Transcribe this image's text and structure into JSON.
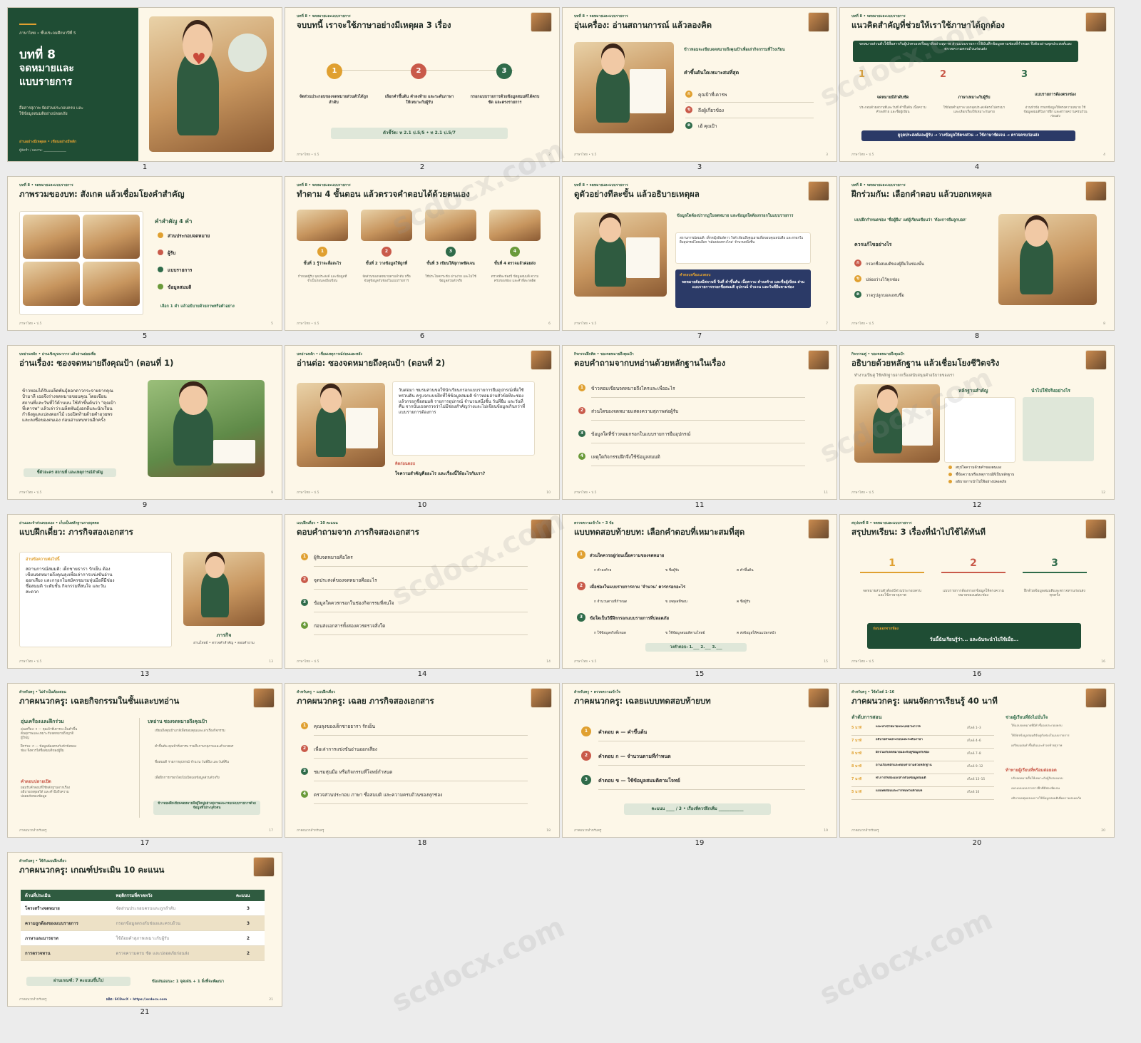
{
  "watermark": "scdocx.com",
  "slides": [
    {
      "n": "1",
      "kicker": "ภาษาไทย • ชั้นประถมศึกษาปีที่ 5",
      "title": "บทที่ 8",
      "title2": "จดหมายและ",
      "title3": "แบบรายการ",
      "desc": "สื่อสารสุภาพ จัดส่วนประกอบครบ และใช้ข้อมูลสมมติอย่างปลอดภัย",
      "tag": "อ่านอย่างมีเหตุผล • เขียนอย่างมีหลัก",
      "sub": "ผู้จัดทำ / ผลงาน: ______________"
    },
    {
      "n": "2",
      "kicker": "บทที่ 8 • จดหมายและแบบรายการ",
      "title": "จบบทนี้ เราจะใช้ภาษาอย่างมีเหตุผล 3 เรื่อง",
      "steps": [
        {
          "k": "1",
          "t": "จัดส่วนประกอบของจดหมายส่วนตัวได้ถูกลำดับ"
        },
        {
          "k": "2",
          "t": "เลือกคำขึ้นต้น คำลงท้าย และระดับภาษาให้เหมาะกับผู้รับ"
        },
        {
          "k": "3",
          "t": "กรอกแบบรายการด้วยข้อมูลสมมติได้ครบ ชัด และตรงรายการ"
        }
      ],
      "note": "ตัวชี้วัด: ท 2.1 ป.5/5 • ท 2.1 ป.5/7",
      "foot": "ภาษาไทย • ป.5",
      "p": "2"
    },
    {
      "n": "3",
      "kicker": "บทที่ 8 • จดหมายและแบบรายการ",
      "title": "อุ่นเครื่อง: อ่านสถานการณ์ แล้วลองคิด",
      "lead": "ข้าวหอมจะเขียนจดหมายถึงคุณป้าเพื่อเล่ากิจกรรมที่โรงเรียน",
      "q": "คำขึ้นต้นใดเหมาะสมที่สุด",
      "opts": [
        {
          "k": "ก",
          "t": "คุณป้าที่เคารพ"
        },
        {
          "k": "ข",
          "t": "ถึงผู้เกี่ยวข้อง"
        },
        {
          "k": "ค",
          "t": "เฮ้ คุณป้า"
        }
      ],
      "foot": "ภาษาไทย • ป.5",
      "p": "3"
    },
    {
      "n": "4",
      "kicker": "บทที่ 8 • จดหมายและแบบรายการ",
      "title": "แนวคิดสำคัญที่ช่วยให้เราใช้ภาษาได้ถูกต้อง",
      "banner": "จดหมายส่วนตัวใช้สื่อสารกับผู้ปกครองหรือญาติอย่างสุภาพ ส่วนแบบรายการใช้บันทึกข้อมูลตามช่องที่กำหนด จึงต้องอ่านจุดประสงค์และตรวจความครบถ้วนก่อนส่ง",
      "cols": [
        {
          "k": "1",
          "h": "จดหมายมีลำดับชัด",
          "t": "ประกอบด้วยสถานที่และวันที่ คำขึ้นต้น เนื้อความ คำลงท้าย และชื่อผู้เขียน"
        },
        {
          "k": "2",
          "h": "ภาษาเหมาะกับผู้รับ",
          "t": "ใช้ถ้อยคำสุภาพ บอกจุดประสงค์ตรงไปตรงมา และเลือกเรื่องให้เหมาะกับสาย"
        },
        {
          "k": "3",
          "h": "แบบรายการต้องตรงช่อง",
          "t": "อ่านหัวข้อ กรอกข้อมูลให้ตรงความหมาย ใช้ข้อมูลสมมติในการฝึก และตรวจความครบถ้วนก่อนส่ง"
        }
      ],
      "bar": "ดูจุดประสงค์และผู้รับ → วางข้อมูลให้ตรงส่วน → ใช้ภาษาชัดเจน → ตรวจครบก่อนส่ง",
      "foot": "ภาษาไทย • ป.5",
      "p": "4"
    },
    {
      "n": "5",
      "kicker": "บทที่ 8 • จดหมายและแบบรายการ",
      "title": "ภาพรวมของบท: สังเกต แล้วเชื่อมโยงคำสำคัญ",
      "h": "คำสำคัญ 4 คำ",
      "items": [
        "ส่วนประกอบจดหมาย",
        "ผู้รับ",
        "แบบรายการ",
        "ข้อมูลสมมติ"
      ],
      "note": "เลือก 1 คำ แล้วอธิบายด้วยภาพหรือตัวอย่าง",
      "foot": "ภาษาไทย • ป.5",
      "p": "5"
    },
    {
      "n": "6",
      "kicker": "บทที่ 8 • จดหมายและแบบรายการ",
      "title": "ทำตาม 4 ขั้นตอน แล้วตรวจคำตอบได้ด้วยตนเอง",
      "steps": [
        {
          "k": "1",
          "h": "ขั้นที่ 1 รู้ว่าจะสื่อสะไร",
          "t": "กำหนดผู้รับ จุดประสงค์ และข้อมูลที่จำเป็นก่อนลงมือเขียน"
        },
        {
          "k": "2",
          "h": "ขั้นที่ 2 วางข้อมูลให้ถูกที่",
          "t": "จัดส่วนของจดหมายตามลำดับ หรือจับคู่ข้อมูลกับช่องในแบบรายการ"
        },
        {
          "k": "3",
          "h": "ขั้นที่ 3 เขียนให้สุภาพชัดเจน",
          "t": "ใช้ประโยคกระชับ อ่านง่าย และไม่ใช้ข้อมูลส่วนตัวจริง"
        },
        {
          "k": "4",
          "h": "ขั้นที่ 4 ตรวจแล้วค่อยส่ง",
          "t": "ตรวจทีละช่องปี ข้อมูลสมมติ ความครบของช่อง และคำที่สะกดผิด"
        }
      ],
      "foot": "ภาษาไทย • ป.5",
      "p": "6"
    },
    {
      "n": "7",
      "kicker": "บทที่ 8 • จดหมายและแบบรายการ",
      "title": "ดูตัวอย่างทีละขั้น แล้วอธิบายเหตุผล",
      "lead": "ข้อมูลใดต้องปรากฏในจดหมาย และข้อมูลใดต้องกรอกในแบบรายการ",
      "case": "สถานการณ์สมมติ: เด็กหญิงพิมพ์ดาว ใจดี เขียนถึงคุณยายเพื่อขอบคุณหนังสือ และกรอกใบยืมอุปกรณ์โดยเลือก 'กล้องส่องทางไกล' จำนวนหนึ่งชิ้น",
      "boxh": "คำตอบหรือแนวตอบ",
      "box": "จดหมายต้องมีสถานที่ วันที่ คำขึ้นต้น เนื้อความ คำลงท้าย และชื่อผู้เขียน ส่วนแบบรายการกรอกชื่อสมมติ อุปกรณ์ จำนวน และวันที่ยืมตามช่อง",
      "foot": "ภาษาไทย • ป.5",
      "p": "7"
    },
    {
      "n": "8",
      "kicker": "บทที่ 8 • จดหมายและแบบรายการ",
      "title": "ฝึกร่วมกัน: เลือกคำตอบ แล้วบอกเหตุผล",
      "lead": "แบบฝึกกำหนดช่อง 'ชื่อผู้ยืม' แต่ผู้เรียนเขียนว่า 'ต้องการยืมลูกบอล'",
      "h": "ควรแก้ไขอย่างไร",
      "items": [
        {
          "k": "ก",
          "t": "กรอกชื่อสมมติของผู้ยืมในช่องนั้น"
        },
        {
          "k": "ข",
          "t": "ปล่อยว่างไว้ทุกช่อง"
        },
        {
          "k": "ค",
          "t": "วาดรูปลูกบอลแทนชื่อ"
        }
      ],
      "foot": "ภาษาไทย • ป.5",
      "p": "8"
    },
    {
      "n": "9",
      "kicker": "บทอ่านหลัก • อ่านเชิงบูรณาการ แล้วอ่านย่อยเพื่อ",
      "title": "อ่านเรื่อง: ซองจดหมายถึงคุณป้า (ตอนที่ 1)",
      "body": "ข้าวหอมได้รับเมล็ดพันธุ์ดอกดาวกระจายจากคุณป้ามาลี เธอจึงร่างจดหมายขอบคุณ โดยเขียนสถานที่และวันที่ไว้ด้านบน ใช้คำขึ้นต้นว่า \"คุณป้าที่เคารพ\" แล้วเล่าว่าเมล็ดพันธุ์งอกดีและนักเรียนกำลังดูแลแปลงดอกไม้ เธอปิดท้ายด้วยคำอวยพร และลงชื่อของตนเอง ก่อนอ่านทบทวนอีกครั้ง",
      "note": "ชี้ตัวละคร สถานที่ และเหตุการณ์สำคัญ",
      "foot": "ภาษาไทย • ป.5",
      "p": "9"
    },
    {
      "n": "10",
      "kicker": "บทอ่านหลัก • เชื่อมเหตุการณ์ก่อนและหลัง",
      "title": "อ่านต่อ: ซองจดหมายถึงคุณป้า (ตอนที่ 2)",
      "body": "วันต่อมา ชมรมสวนขอให้นักเรียนกรอกแบบรายการยืมอุปกรณ์เพื่อใช้พรวนดิน ครูแจกแบบฝึกที่ใช้ข้อมูลสมมติ ข้าวหอมอ่านหัวข้อทีละช่อง แล้วกรอกชื่อสมมติ รายการอุปกรณ์ จำนวนหนึ่งชิ้น วันที่ยืม และวันที่คืน จากนั้นเธอตรวจว่าไม่มีช่องสำคัญว่างและไม่เขียนข้อมูลเกินกว่าที่แบบรายการต้องการ",
      "h": "คิดก่อนตอบ",
      "q": "ใจความสำคัญคืออะไร และเรื่องนี้ให้อะไรกับเรา?",
      "foot": "ภาษาไทย • ป.5",
      "p": "10"
    },
    {
      "n": "11",
      "kicker": "กิจกรรมฝึกคิด • ของจดหมายถึงคุณป้า",
      "title": "ตอบคำถามจากบทอ่านด้วยหลักฐานในเรื่อง",
      "items": [
        "ข้าวหอมเขียนจดหมายถึงใครและเพื่ออะไร",
        "ส่วนใดของจดหมายแสดงความสุภาพต่อผู้รับ",
        "ข้อมูลใดที่ข้าวหอมกรอกในแบบรายการยืมอุปกรณ์",
        "เหตุใดกิจกรรมฝึกจึงใช้ข้อมูลสมมติ"
      ],
      "foot": "ภาษาไทย • ป.5",
      "p": "11"
    },
    {
      "n": "12",
      "kicker": "กิจกรรมคู่ • ของจดหมายถึงคุณป้า",
      "title": "อธิบายด้วยหลักฐาน แล้วเชื่อมโยงชีวิตจริง",
      "lead": "ทำงานเป็นคู่ ใช้หลักฐานจากเรื่องสนับสนุนคำอธิบายของเรา",
      "h1": "หลักฐานสำคัญ",
      "h2": "นำไปใช้จริงอย่างไร",
      "bul": [
        "สรุปใจความด้วยคำของตนเอง",
        "ชี้ข้อความหรือเหตุการณ์ที่เป็นหลักฐาน",
        "อธิบายการนำไปใช้อย่างปลอดภัย"
      ],
      "foot": "ภาษาไทย • ป.5",
      "p": "12"
    },
    {
      "n": "13",
      "kicker": "อ่านและจำส่วนของเอง • เก็บเป็นหลักฐานรายบุคคล",
      "title": "แบบฝึกเดี่ยว: ภารกิจสองเอกสาร",
      "h": "อ่านข้อความต่อไปนี้",
      "body": "สถานการณ์สมมติ: เด็กชายธารา รักเย็น ต้องเขียนจดหมายถึงคุณลุงเพื่อเล่าการแข่งขันอ่านออกเสียง และกรอกใบสมัครชมรมหุ่นมือที่มีช่องชื่อสมมติ ระดับชั้น กิจกรรมที่สนใจ และวันสะดวก",
      "cap": "ภารกิจ",
      "capsub": "อ่านโจทย์ • ตรวจคำสำคัญ • ตอบคำถาม",
      "foot": "ภาษาไทย • ป.5",
      "p": "13"
    },
    {
      "n": "14",
      "kicker": "แบบฝึกเดี่ยว • 10 คะแนน",
      "title": "ตอบคำถามจาก ภารกิจสองเอกสาร",
      "items": [
        "ผู้รับจดหมายคือใคร",
        "จุดประสงค์ของจดหมายคืออะไร",
        "ข้อมูลใดควรกรอกในช่องกิจกรรมที่สนใจ",
        "ก่อนส่งเอกสารทั้งสองควรตรวจสิ่งใด"
      ],
      "foot": "ภาษาไทย • ป.5",
      "p": "14"
    },
    {
      "n": "15",
      "kicker": "ตรวจความเข้าใจ • 3 ข้อ",
      "title": "แบบทดสอบท้ายบท: เลือกคำตอบที่เหมาะสมที่สุด",
      "qs": [
        {
          "k": "1",
          "q": "ส่วนใดควรอยู่ก่อนเนื้อความของจดหมาย",
          "o": [
            "ก คำลงท้าย",
            "ข ชื่อผู้รับ",
            "ค คำขึ้นต้น"
          ]
        },
        {
          "k": "2",
          "q": "เมื่อช่องในแบบรายการถาม 'จำนวน' ควรกรอกอะไร",
          "o": [
            "ก จำนวนตามที่กำหนด",
            "ข เหตุผลที่ชอบ",
            "ค ชื่อผู้รับ"
          ]
        },
        {
          "k": "3",
          "q": "ข้อใดเป็นวิธีฝึกกรอกแบบรายการที่ปลอดภัย",
          "o": [
            "ก ใช้ข้อมูลจริงทั้งหมด",
            "ข ใช้ข้อมูลสมมติตามโจทย์",
            "ค ส่งข้อมูลให้คนแปลกหน้า"
          ]
        }
      ],
      "note": "วงคำตอบ: 1.___ 2.___ 3.___",
      "foot": "ภาษาไทย • ป.5",
      "p": "15"
    },
    {
      "n": "16",
      "kicker": "สรุปบทที่ 8 • จดหมายและแบบรายการ",
      "title": "สรุปบทเรียน: 3 เรื่องที่นำไปใช้ได้ทันที",
      "cols": [
        {
          "k": "1",
          "t": "จดหมายส่วนตัวต้องมีส่วนประกอบครบและใช้ภาษาสุภาพ"
        },
        {
          "k": "2",
          "t": "แบบรายการต้องกรอกข้อมูลให้ตรงความหมายของแต่ละช่อง"
        },
        {
          "k": "3",
          "t": "ฝึกด้วยข้อมูลสมมติและตรวจทานก่อนส่งทุกครั้ง"
        }
      ],
      "bh": "ก่อนออกจากห้อง",
      "b": "วันนี้ฉันเรียนรู้ว่า... และฉันจะนำไปใช้เมื่อ...",
      "foot": "ภาษาไทย • ป.5",
      "p": "16"
    },
    {
      "n": "17",
      "kicker": "สำหรับครู • ไม่จำเป็นต้องสอน",
      "title": "ภาคผนวกครู: เฉลยกิจกรรมในชั้นและบทอ่าน",
      "lh": "อุ่นเครื่องและฝึกร่วม",
      "lt": "อุ่นเครื่อง: ก — คุณป้าที่เคารพ เป็นคำขึ้นต้นสุภาพและเหมาะกับจดหมายถึงญาติผู้ใหญ่\n\nฝึกร่วม: ก — ข้อมูลต้องตรงกับหัวข้อของช่อง จึงควรใส่ชื่อสมมติของผู้ยืม",
      "lh2": "คำตอบปลายเปิด",
      "lt2": "ยอมรับคำตอบที่ใช้หลักฐานจากเรื่อง อธิบายเหตุผลได้ และคำนึงถึงความปลอดภัยของข้อมูล",
      "rh": "บทอ่าน ซองจดหมายถึงคุณป้า",
      "rb": [
        "เขียนถึงคุณป้ามาลีเพื่อขอบคุณและเล่าเรื่องกิจกรรม",
        "คำขึ้นต้น คุณป้าที่เคารพ รวมถึงภาษาสุภาพและคำอวยพร",
        "ชื่อสมมติ รายการอุปกรณ์ จำนวน วันที่ยืม และวันที่คืน",
        "เพื่อฝึกการกรอกโดยไม่เปิดเผยข้อมูลส่วนตัวจริง"
      ],
      "note": "ข้าวหอมฝึกเขียนจดหมายถึงผู้ใหญ่อย่างสุภาพและกรอกแบบรายการด้วยข้อมูลที่ไม่ระบุตัวตน",
      "foot": "ภาคผนวกสำหรับครู",
      "p": "17"
    },
    {
      "n": "18",
      "kicker": "สำหรับครู • แบบฝึกเดี่ยว",
      "title": "ภาคผนวกครู: เฉลย ภารกิจสองเอกสาร",
      "items": [
        "คุณลุงของเด็กชายธารา รักเย็น",
        "เพื่อเล่าการแข่งขันอ่านออกเสียง",
        "ชมรมหุ่นมือ หรือกิจกรรมที่โจทย์กำหนด",
        "ตรวจส่วนประกอบ ภาษา ชื่อสมมติ และความครบถ้วนของทุกช่อง"
      ],
      "foot": "ภาคผนวกสำหรับครู",
      "p": "18"
    },
    {
      "n": "19",
      "kicker": "สำหรับครู • ตรวจความเข้าใจ",
      "title": "ภาคผนวกครู: เฉลยแบบทดสอบท้ายบท",
      "items": [
        "คำตอบ ค — คำขึ้นต้น",
        "คำตอบ ก — จำนวนตามที่กำหนด",
        "คำตอบ ข — ใช้ข้อมูลสมมติตามโจทย์"
      ],
      "note": "คะแนน ____ / 3 • เรื่องที่ควรฝึกเพิ่ม ____________",
      "foot": "ภาคผนวกสำหรับครู",
      "p": "19"
    },
    {
      "n": "20",
      "kicker": "สำหรับครู • ใช้สไลด์ 1–16",
      "title": "ภาคผนวกครู: แผนจัดการเรียนรู้ 40 นาที",
      "lh": "ลำดับการสอน",
      "rows": [
        {
          "m": "5 นาที",
          "t": "แนะนำเป้าหมายและบทอ่านการจ",
          "s": "สไลด์ 1–3"
        },
        {
          "m": "7 นาที",
          "t": "อธิบายส่วนประกอบและระดับภาษา",
          "s": "สไลด์ 4–6"
        },
        {
          "m": "8 นาที",
          "t": "ฝึกร่วมกับจดหมายและจับคู่ข้อมูลกับช่อง",
          "s": "สไลด์ 7–8"
        },
        {
          "m": "8 นาที",
          "t": "อ่านเรื่องหลักและตอบคำถามด้วยหลักฐาน",
          "s": "สไลด์ 9–12"
        },
        {
          "m": "7 นาที",
          "t": "ทำภารกิจสองเอกสารด้วยข้อมูลสมมติ",
          "s": "สไลด์ 13–15"
        },
        {
          "m": "5 นาที",
          "t": "แบบทดสอบและการทบทวนท้ายบท",
          "s": "สไลด์ 16"
        }
      ],
      "rh": "ช่วยผู้เรียนที่ยังไม่มั่นใจ",
      "rb": [
        "ให้แถบจดหมายที่มีคำชี้แจงประกอบครบ",
        "ใช้บัตรข้อมูลสมมติจับคู่กับช่องในแบบรายการ",
        "เตรียมแผ่นคำขึ้นต้นและคำลงท้ายสุภาพ"
      ],
      "rh2": "ท้าทายผู้เรียนที่พร้อมต่อยอด",
      "rb2": [
        "ปรับจดหมายสั้นให้เหมาะกับผู้รับสองแบบ",
        "ออกแบบแบบรายการฝึกที่มีช่องชัดเจน",
        "อธิบายเหตุผลของการใช้ข้อมูลสมมติเพื่อความปลอดภัย"
      ],
      "foot": "ภาคผนวกสำหรับครู",
      "p": "20"
    },
    {
      "n": "21",
      "kicker": "สำหรับครู • ใช้กับแบบฝึกเดี่ยว",
      "title": "ภาคผนวกครู: เกณฑ์ประเมิน 10 คะแนน",
      "th": [
        "ด้านที่ประเมิน",
        "พฤติกรรมที่คาดหวัง",
        "คะแนน"
      ],
      "tr": [
        [
          "โครงสร้างจดหมาย",
          "จัดส่วนประกอบครบและถูกลำดับ",
          "3"
        ],
        [
          "ความถูกต้องของแบบรายการ",
          "กรอกข้อมูลตรงกับช่องและครบถ้วน",
          "3"
        ],
        [
          "ภาษาและมารยาท",
          "ใช้ถ้อยคำสุภาพเหมาะกับผู้รับ",
          "2"
        ],
        [
          "การตรวจทาน",
          "ตรวจความครบ ชัด และปลอดภัยก่อนส่ง",
          "2"
        ]
      ],
      "pass": "ผ่านเกณฑ์: 7 คะแนนขึ้นไป",
      "tip": "ข้อเสนอแนะ: 1 จุดเด่น + 1 สิ่งที่จะพัฒนา",
      "credit": "ผลิต: SCDocX • https://scdocx.com",
      "foot": "ภาคผนวกสำหรับครู",
      "p": "21"
    }
  ]
}
